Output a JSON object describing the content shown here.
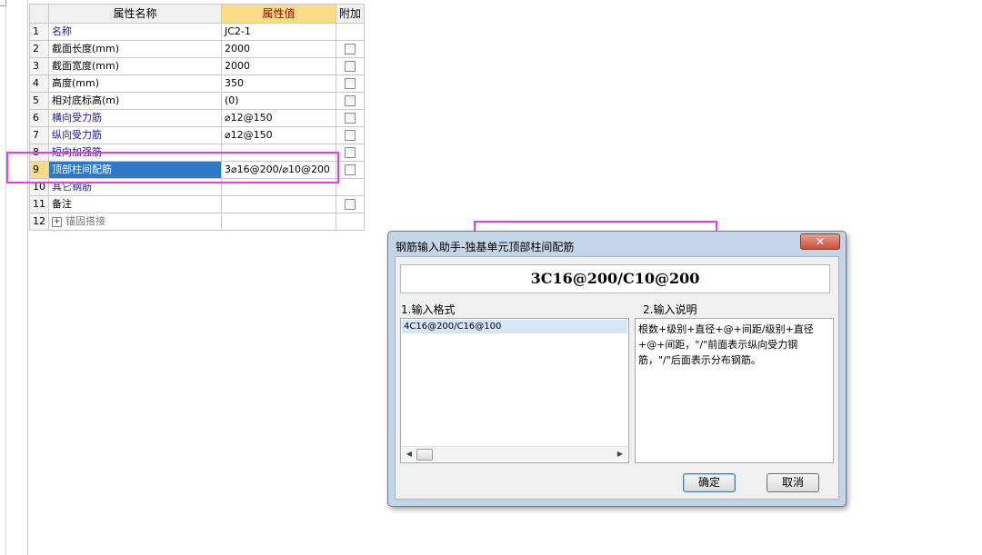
{
  "table": {
    "headers": {
      "num": "",
      "name": "属性名称",
      "value": "属性值",
      "extra": "附加"
    },
    "rows": [
      {
        "num": "1",
        "name": "名称",
        "value": "JC2-1",
        "style": "blue",
        "checkbox": false
      },
      {
        "num": "2",
        "name": "截面长度(mm)",
        "value": "2000",
        "style": "black",
        "checkbox": true
      },
      {
        "num": "3",
        "name": "截面宽度(mm)",
        "value": "2000",
        "style": "black",
        "checkbox": true
      },
      {
        "num": "4",
        "name": "高度(mm)",
        "value": "350",
        "style": "black",
        "checkbox": true
      },
      {
        "num": "5",
        "name": "相对底标高(m)",
        "value": "(0)",
        "style": "black",
        "checkbox": true
      },
      {
        "num": "6",
        "name": "横向受力筋",
        "value": "⌀12@150",
        "style": "blue",
        "checkbox": true
      },
      {
        "num": "7",
        "name": "纵向受力筋",
        "value": "⌀12@150",
        "style": "blue",
        "checkbox": true
      },
      {
        "num": "8",
        "name": "短向加强筋",
        "value": "",
        "style": "blue",
        "checkbox": true
      },
      {
        "num": "9",
        "name": "顶部柱间配筋",
        "value": "3⌀16@200/⌀10@200",
        "style": "selected",
        "checkbox": true
      },
      {
        "num": "10",
        "name": "其它钢筋",
        "value": "",
        "style": "blue",
        "checkbox": false
      },
      {
        "num": "11",
        "name": "备注",
        "value": "",
        "style": "black",
        "checkbox": true
      },
      {
        "num": "12",
        "name": "锚固搭接",
        "value": "",
        "style": "gray",
        "checkbox": false,
        "expandable": true,
        "expand_symbol": "+"
      }
    ]
  },
  "dialog": {
    "title": "钢筋输入助手-独基单元顶部柱间配筋",
    "close_symbol": "✕",
    "result_text": "3C16@200/C10@200",
    "format_label": "1.输入格式",
    "format_items": [
      "4C16@200/C16@100"
    ],
    "desc_label": "2.输入说明",
    "description": "根数+级别+直径+@+间距/级别+直径+@+间距，\"/\"前面表示纵向受力钢筋，\"/\"后面表示分布钢筋。",
    "ok_label": "确定",
    "cancel_label": "取消",
    "scroll_left": "◀",
    "scroll_right": "▶"
  },
  "colors": {
    "highlight_annotation": "#e040e0",
    "selected_row": "#2f78c8",
    "header_highlight": "#f8dc88"
  }
}
